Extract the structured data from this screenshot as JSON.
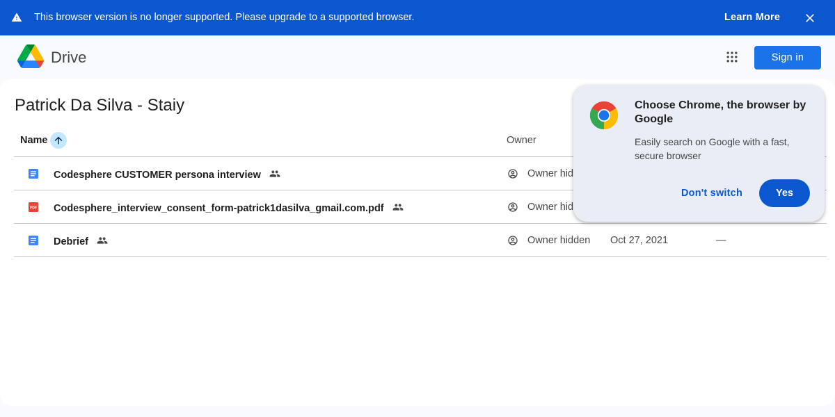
{
  "banner": {
    "message": "This browser version is no longer supported. Please upgrade to a supported browser.",
    "learn_more": "Learn More",
    "icons": {
      "warning": "warning-icon",
      "close": "close-icon"
    }
  },
  "header": {
    "product": "Drive",
    "sign_in": "Sign in",
    "icons": {
      "logo": "drive-logo-icon",
      "apps": "apps-grid-icon"
    }
  },
  "folder": {
    "title": "Patrick Da Silva - Staiy"
  },
  "table": {
    "columns": {
      "name": "Name",
      "owner": "Owner"
    },
    "rows": [
      {
        "name": "Codesphere CUSTOMER persona interview",
        "type": "doc",
        "owner": "Owner hidden",
        "date": "",
        "size": ""
      },
      {
        "name": "Codesphere_interview_consent_form-patrick1dasilva_gmail.com.pdf",
        "type": "pdf",
        "owner": "Owner hidden",
        "date": "",
        "size": ""
      },
      {
        "name": "Debrief",
        "type": "doc",
        "owner": "Owner hidden",
        "date": "Oct 27, 2021",
        "size": "—"
      }
    ]
  },
  "promo": {
    "title": "Choose Chrome, the browser by Google",
    "description": "Easily search on Google with a fast, secure browser",
    "dont_switch": "Don't switch",
    "yes": "Yes"
  },
  "colors": {
    "banner": "#0b57d0",
    "accent": "#1a73e8",
    "doc": "#4285f4",
    "pdf": "#ea4335"
  }
}
